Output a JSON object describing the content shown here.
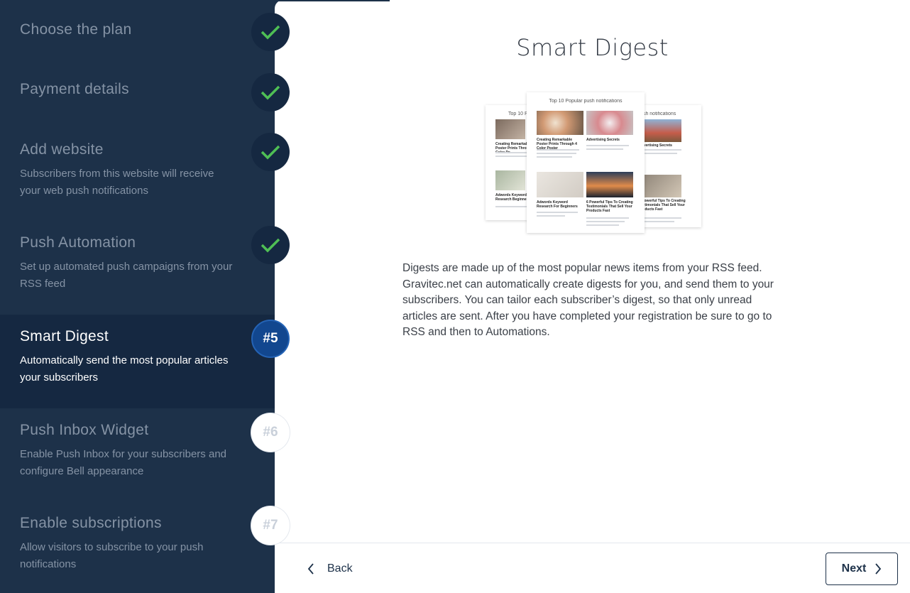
{
  "steps": [
    {
      "title": "Choose the plan",
      "desc": "",
      "state": "done"
    },
    {
      "title": "Payment details",
      "desc": "",
      "state": "done"
    },
    {
      "title": "Add website",
      "desc": "Subscribers from this website will receive your web push notifications",
      "state": "done"
    },
    {
      "title": "Push Automation",
      "desc": "Set up automated push campaigns from your RSS feed",
      "state": "done"
    },
    {
      "title": "Smart Digest",
      "desc": "Automatically send the most popular articles your subscribers",
      "state": "current",
      "badge": "#5"
    },
    {
      "title": "Push Inbox Widget",
      "desc": "Enable Push Inbox for your subscribers and configure Bell appearance",
      "state": "todo",
      "badge": "#6"
    },
    {
      "title": "Enable subscriptions",
      "desc": "Allow visitors to subscribe to your push notifications",
      "state": "todo",
      "badge": "#7"
    }
  ],
  "main": {
    "title": "Smart Digest",
    "description": "Digests are made up of the most popular news items from your RSS feed. Gravitec.net can automatically create digests for you, and send them to your subscribers. You can tailor each subscriber’s digest, so that only unread articles are sent. After you have completed your registration be sure to go to RSS and then to Automations.",
    "illustration": {
      "front_title": "Top 10 Popular push notifications",
      "left_title": "Top 10 Pop",
      "right_title": "ar push notifications",
      "captions": [
        "Creating Remarkable Poster Prints Through 4 Color Poster",
        "Advertising Secrets",
        "Adwords Keyword Research For Beginners",
        "6 Powerful Tips To Creating Testimonials That Sell Your Products Fast"
      ],
      "left_captions": [
        "Creating Remarkable Poster Prints Through 4 Color Po",
        "Adwords Keyword Research Beginners"
      ],
      "right_captions": [
        "Advertising Secrets",
        "6 Powerful Tips To Creating Testimonials That Sell Your Products Fast"
      ]
    }
  },
  "footer": {
    "back_label": "Back",
    "next_label": "Next"
  },
  "colors": {
    "sidebar": "#1d3149",
    "active": "#152841",
    "check": "#4fbf55",
    "current_badge": "#12478f"
  }
}
